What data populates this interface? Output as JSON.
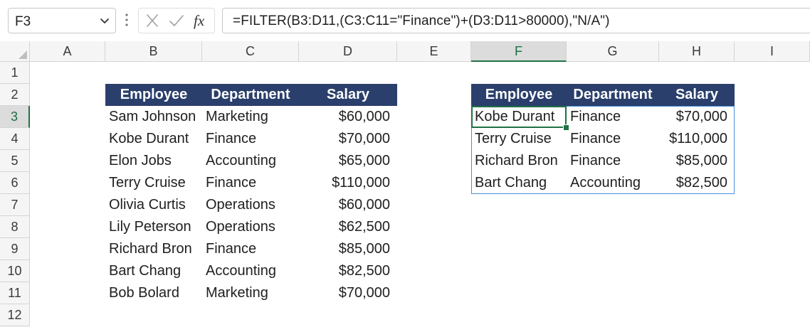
{
  "formula_bar": {
    "name_box": "F3",
    "formula": "=FILTER(B3:D11,(C3:C11=\"Finance\")+(D3:D11>80000),\"N/A\")",
    "icons": {
      "cancel": "close-icon",
      "enter": "check-icon",
      "insert_function": "fx-icon"
    },
    "fx_label": "fx"
  },
  "sheet": {
    "columns": [
      "A",
      "B",
      "C",
      "D",
      "E",
      "F",
      "G",
      "H",
      "I"
    ],
    "rows": [
      "1",
      "2",
      "3",
      "4",
      "5",
      "6",
      "7",
      "8",
      "9",
      "10",
      "11",
      "12"
    ],
    "active_cell": "F3",
    "accent_color": "#217346",
    "header_fill_color": "#2a3f6b"
  },
  "source_table": {
    "headers": [
      "Employee",
      "Department",
      "Salary"
    ],
    "rows": [
      [
        "Sam Johnson",
        "Marketing",
        "$60,000"
      ],
      [
        "Kobe Durant",
        "Finance",
        "$70,000"
      ],
      [
        "Elon Jobs",
        "Accounting",
        "$65,000"
      ],
      [
        "Terry Cruise",
        "Finance",
        "$110,000"
      ],
      [
        "Olivia Curtis",
        "Operations",
        "$60,000"
      ],
      [
        "Lily Peterson",
        "Operations",
        "$62,500"
      ],
      [
        "Richard Bron",
        "Finance",
        "$85,000"
      ],
      [
        "Bart Chang",
        "Accounting",
        "$82,500"
      ],
      [
        "Bob Bolard",
        "Marketing",
        "$70,000"
      ]
    ]
  },
  "result_table": {
    "headers": [
      "Employee",
      "Department",
      "Salary"
    ],
    "rows": [
      [
        "Kobe Durant",
        "Finance",
        "$70,000"
      ],
      [
        "Terry Cruise",
        "Finance",
        "$110,000"
      ],
      [
        "Richard Bron",
        "Finance",
        "$85,000"
      ],
      [
        "Bart Chang",
        "Accounting",
        "$82,500"
      ]
    ]
  }
}
